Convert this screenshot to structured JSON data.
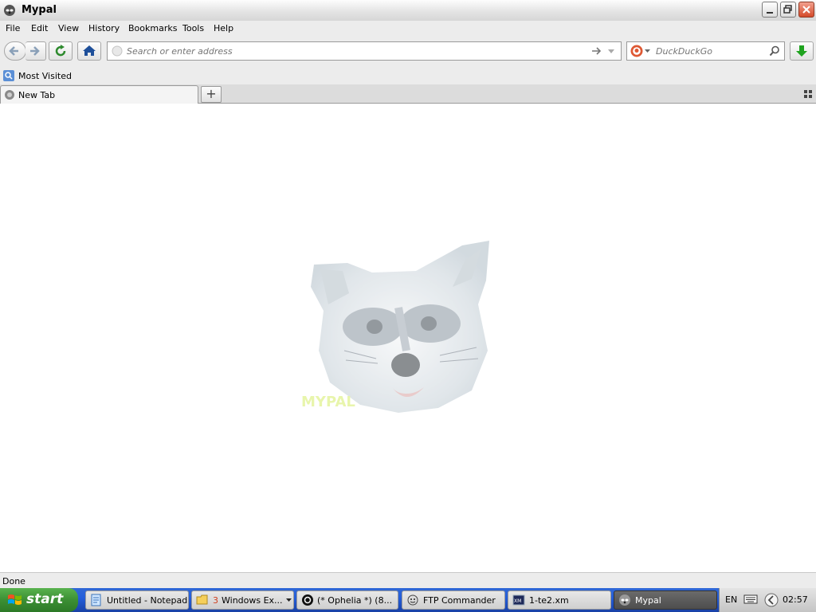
{
  "window": {
    "title": "Mypal"
  },
  "menu": [
    "File",
    "Edit",
    "View",
    "History",
    "Bookmarks",
    "Tools",
    "Help"
  ],
  "urlbar": {
    "placeholder": "Search or enter address"
  },
  "search": {
    "engine": "DuckDuckGo"
  },
  "bookmarks": {
    "most_visited": "Most Visited"
  },
  "tab": {
    "label": "New Tab"
  },
  "status": {
    "text": "Done"
  },
  "taskbar": {
    "start": "start",
    "tasks": [
      {
        "label": "Untitled - Notepad"
      },
      {
        "count": "3",
        "label": "Windows Ex..."
      },
      {
        "label": "(* Ophelia *) (8..."
      },
      {
        "label": "FTP Commander"
      },
      {
        "label": "1-te2.xm"
      },
      {
        "label": "Mypal"
      }
    ],
    "lang": "EN",
    "clock": "02:57"
  },
  "colors": {
    "accent_green": "#1fa31f",
    "taskbar_blue": "#245edb",
    "close_red": "#d44a2a"
  }
}
